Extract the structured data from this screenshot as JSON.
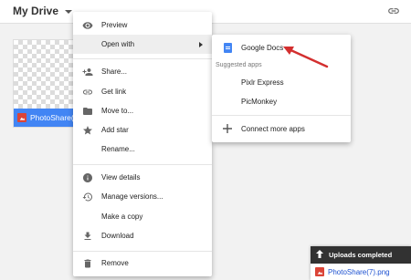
{
  "header": {
    "title": "My Drive",
    "dropdown_icon": "caret-down-icon",
    "link_icon": "link-icon"
  },
  "file": {
    "name": "PhotoShare(7).png",
    "icon": "image-icon"
  },
  "context_menu": {
    "items": [
      {
        "label": "Preview",
        "icon": "eye-icon"
      },
      {
        "label": "Open with",
        "icon": "none"
      },
      {
        "label": "Share...",
        "icon": "person-add-icon"
      },
      {
        "label": "Get link",
        "icon": "link-icon"
      },
      {
        "label": "Move to...",
        "icon": "folder-icon"
      },
      {
        "label": "Add star",
        "icon": "star-icon"
      },
      {
        "label": "Rename...",
        "icon": "none"
      },
      {
        "label": "View details",
        "icon": "info-icon"
      },
      {
        "label": "Manage versions...",
        "icon": "history-icon"
      },
      {
        "label": "Make a copy",
        "icon": "none"
      },
      {
        "label": "Download",
        "icon": "download-icon"
      },
      {
        "label": "Remove",
        "icon": "trash-icon"
      }
    ]
  },
  "submenu": {
    "primary": {
      "label": "Google Docs",
      "icon": "google-docs-icon"
    },
    "heading": "Suggested apps",
    "suggested": [
      {
        "label": "Pixlr Express"
      },
      {
        "label": "PicMonkey"
      }
    ],
    "connect": {
      "label": "Connect more apps",
      "icon": "plus-icon"
    }
  },
  "uploads": {
    "header": "Uploads completed",
    "file": "PhotoShare(7).png"
  },
  "colors": {
    "accent": "#4285f4",
    "annotation": "#d32f2f",
    "panel_dark": "#323232",
    "link": "#1a4fd0"
  }
}
